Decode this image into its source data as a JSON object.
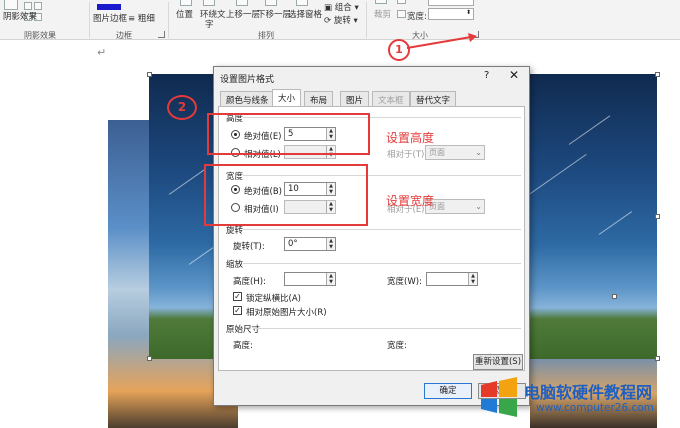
{
  "ribbon": {
    "buttons": {
      "shadow_effects": "阴影效果",
      "picture_border": "图片边框",
      "border_style": "粗细",
      "position": "位置",
      "wrap_text": "环绕文",
      "wrap_text_line2": "字",
      "bring_forward": "上移一层",
      "send_backward": "下移一层",
      "selection_pane": "选择窗格",
      "group": "组合",
      "rotate": "旋转",
      "crop": "裁剪",
      "width_label": "宽度:"
    },
    "groups": {
      "shadow_effects": "阴影效果",
      "border": "边框",
      "arrange": "排列",
      "size": "大小"
    }
  },
  "document": {
    "return_mark": "↵"
  },
  "annotations": {
    "circle1": "1",
    "circle2": "2",
    "set_height": "设置高度",
    "set_width": "设置宽度"
  },
  "dialog": {
    "title": "设置图片格式",
    "help": "?",
    "close": "✕",
    "tabs": [
      {
        "label": "颜色与线条",
        "state": "normal"
      },
      {
        "label": "大小",
        "state": "active"
      },
      {
        "label": "布局",
        "state": "normal"
      },
      {
        "label": "图片",
        "state": "normal"
      },
      {
        "label": "文本框",
        "state": "disabled"
      },
      {
        "label": "替代文字",
        "state": "normal"
      }
    ],
    "height": {
      "section": "高度",
      "absolute_label": "绝对值(E)",
      "absolute_value": "5",
      "relative_label": "相对值(L)",
      "relative_to_label": "相对于(T)",
      "relative_to_value": "页面"
    },
    "width": {
      "section": "宽度",
      "absolute_label": "绝对值(B)",
      "absolute_value": "10",
      "relative_label": "相对值(I)",
      "relative_to_label": "相对于(E)",
      "relative_to_value": "页面"
    },
    "rotation": {
      "section": "旋转",
      "label": "旋转(T):",
      "value": "0°"
    },
    "scale": {
      "section": "缩放",
      "height_label": "高度(H):",
      "width_label": "宽度(W):",
      "lock_aspect": "锁定纵横比(A)",
      "relative_original": "相对原始图片大小(R)"
    },
    "original_size": {
      "section": "原始尺寸",
      "height_label": "高度:",
      "width_label": "宽度:",
      "reset_button": "重新设置(S)"
    },
    "ok_button": "确定",
    "cancel_button": "取消"
  },
  "watermark": {
    "text": "电脑软硬件教程网",
    "url": "www.computer26.com"
  }
}
